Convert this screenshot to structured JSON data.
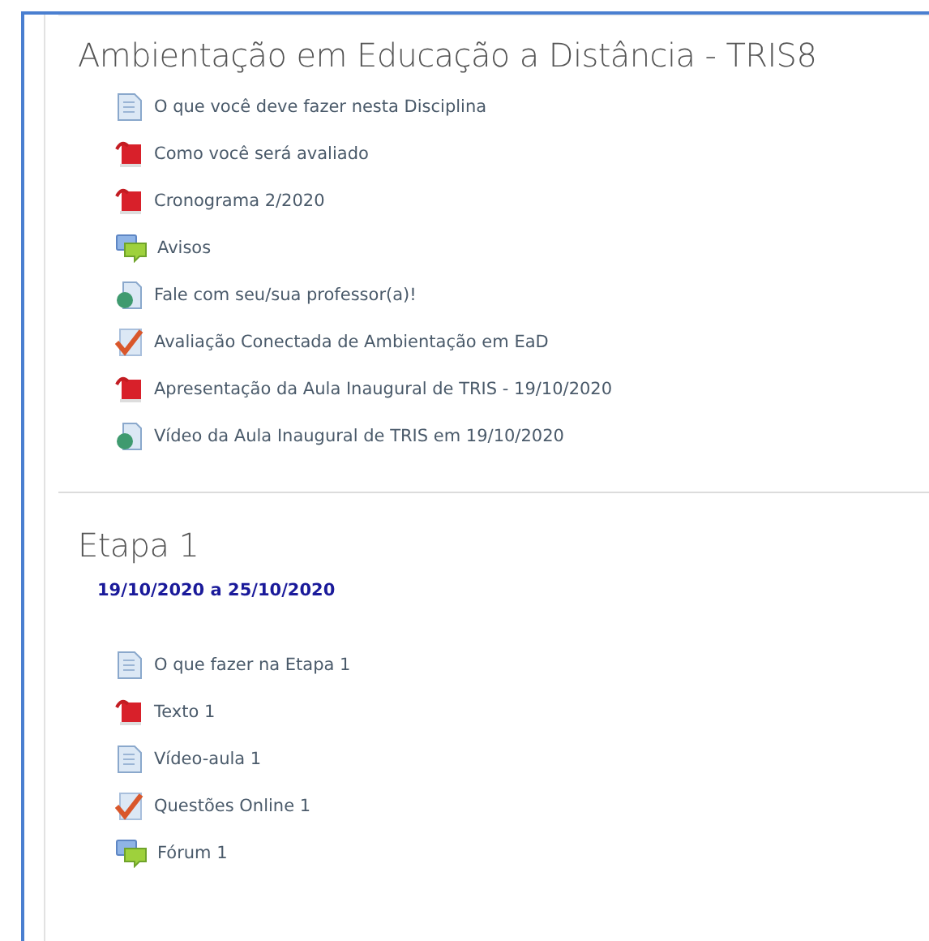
{
  "sections": [
    {
      "title": "Ambientação em Educação a Distância - TRIS8",
      "items": [
        {
          "kind": "page",
          "label": "O que você deve fazer nesta Disciplina"
        },
        {
          "kind": "pdf",
          "label": "Como você será avaliado"
        },
        {
          "kind": "pdf",
          "label": "Cronograma 2/2020"
        },
        {
          "kind": "forum",
          "label": "Avisos"
        },
        {
          "kind": "url",
          "label": "Fale com seu/sua professor(a)!"
        },
        {
          "kind": "quiz",
          "label": "Avaliação Conectada de Ambientação em EaD"
        },
        {
          "kind": "pdf",
          "label": "Apresentação da Aula Inaugural de TRIS - 19/10/2020"
        },
        {
          "kind": "url",
          "label": "Vídeo da Aula Inaugural de TRIS em 19/10/2020"
        }
      ]
    },
    {
      "title": "Etapa 1",
      "dates": "19/10/2020 a 25/10/2020",
      "items": [
        {
          "kind": "page",
          "label": "O que fazer na Etapa 1"
        },
        {
          "kind": "pdf",
          "label": "Texto 1"
        },
        {
          "kind": "page",
          "label": "Vídeo-aula 1"
        },
        {
          "kind": "quiz",
          "label": "Questões Online 1"
        },
        {
          "kind": "forum",
          "label": "Fórum 1"
        }
      ]
    }
  ]
}
